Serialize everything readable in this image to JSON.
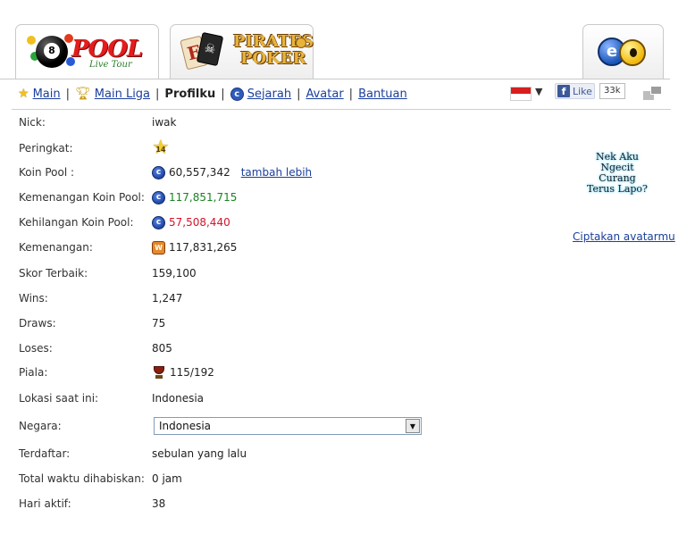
{
  "tabs": [
    {
      "logo_main": "POOL",
      "logo_sub": "Live Tour"
    },
    {
      "logo_line1": "PIRATES",
      "logo_line2": "POKER"
    },
    {
      "logo": "eo"
    }
  ],
  "nav": {
    "items": [
      {
        "label": "Main",
        "icon": "star-icon"
      },
      {
        "label": "Main Liga",
        "icon": "trophy-icon"
      },
      {
        "label": "Profilku",
        "current": true
      },
      {
        "label": "Sejarah",
        "icon": "coin-icon"
      },
      {
        "label": "Avatar"
      },
      {
        "label": "Bantuan"
      }
    ],
    "separator": "|"
  },
  "social": {
    "flag": "indonesia-flag-icon",
    "like_label": "Like",
    "like_count": "33k"
  },
  "profile": {
    "nick": {
      "label": "Nick:",
      "value": "iwak"
    },
    "rank": {
      "label": "Peringkat:",
      "value": "14"
    },
    "coins": {
      "label": "Koin Pool :",
      "value": "60,557,342",
      "link": "tambah lebih"
    },
    "coins_won": {
      "label": "Kemenangan Koin Pool:",
      "value": "117,851,715"
    },
    "coins_lost": {
      "label": "Kehilangan Koin Pool:",
      "value": "57,508,440"
    },
    "winnings": {
      "label": "Kemenangan:",
      "value": "117,831,265"
    },
    "best_score": {
      "label": "Skor Terbaik:",
      "value": "159,100"
    },
    "wins": {
      "label": "Wins:",
      "value": "1,247"
    },
    "draws": {
      "label": "Draws:",
      "value": "75"
    },
    "loses": {
      "label": "Loses:",
      "value": "805"
    },
    "trophies": {
      "label": "Piala:",
      "value": "115/192"
    },
    "location": {
      "label": "Lokasi saat ini:",
      "value": "Indonesia"
    },
    "country": {
      "label": "Negara:",
      "value": "Indonesia"
    },
    "registered": {
      "label": "Terdaftar:",
      "value": "sebulan yang lalu"
    },
    "time_spent": {
      "label": "Total waktu dihabiskan:",
      "value": "0 jam"
    },
    "active_days": {
      "label": "Hari aktif:",
      "value": "38"
    }
  },
  "avatar": {
    "lines": [
      "Nek Aku",
      "Ngecit",
      "Curang",
      "Terus Lapo?"
    ],
    "create_link": "Ciptakan avatarmu"
  },
  "colors": {
    "link": "#1a3f9c",
    "positive": "#18841f",
    "negative": "#d3142a"
  }
}
